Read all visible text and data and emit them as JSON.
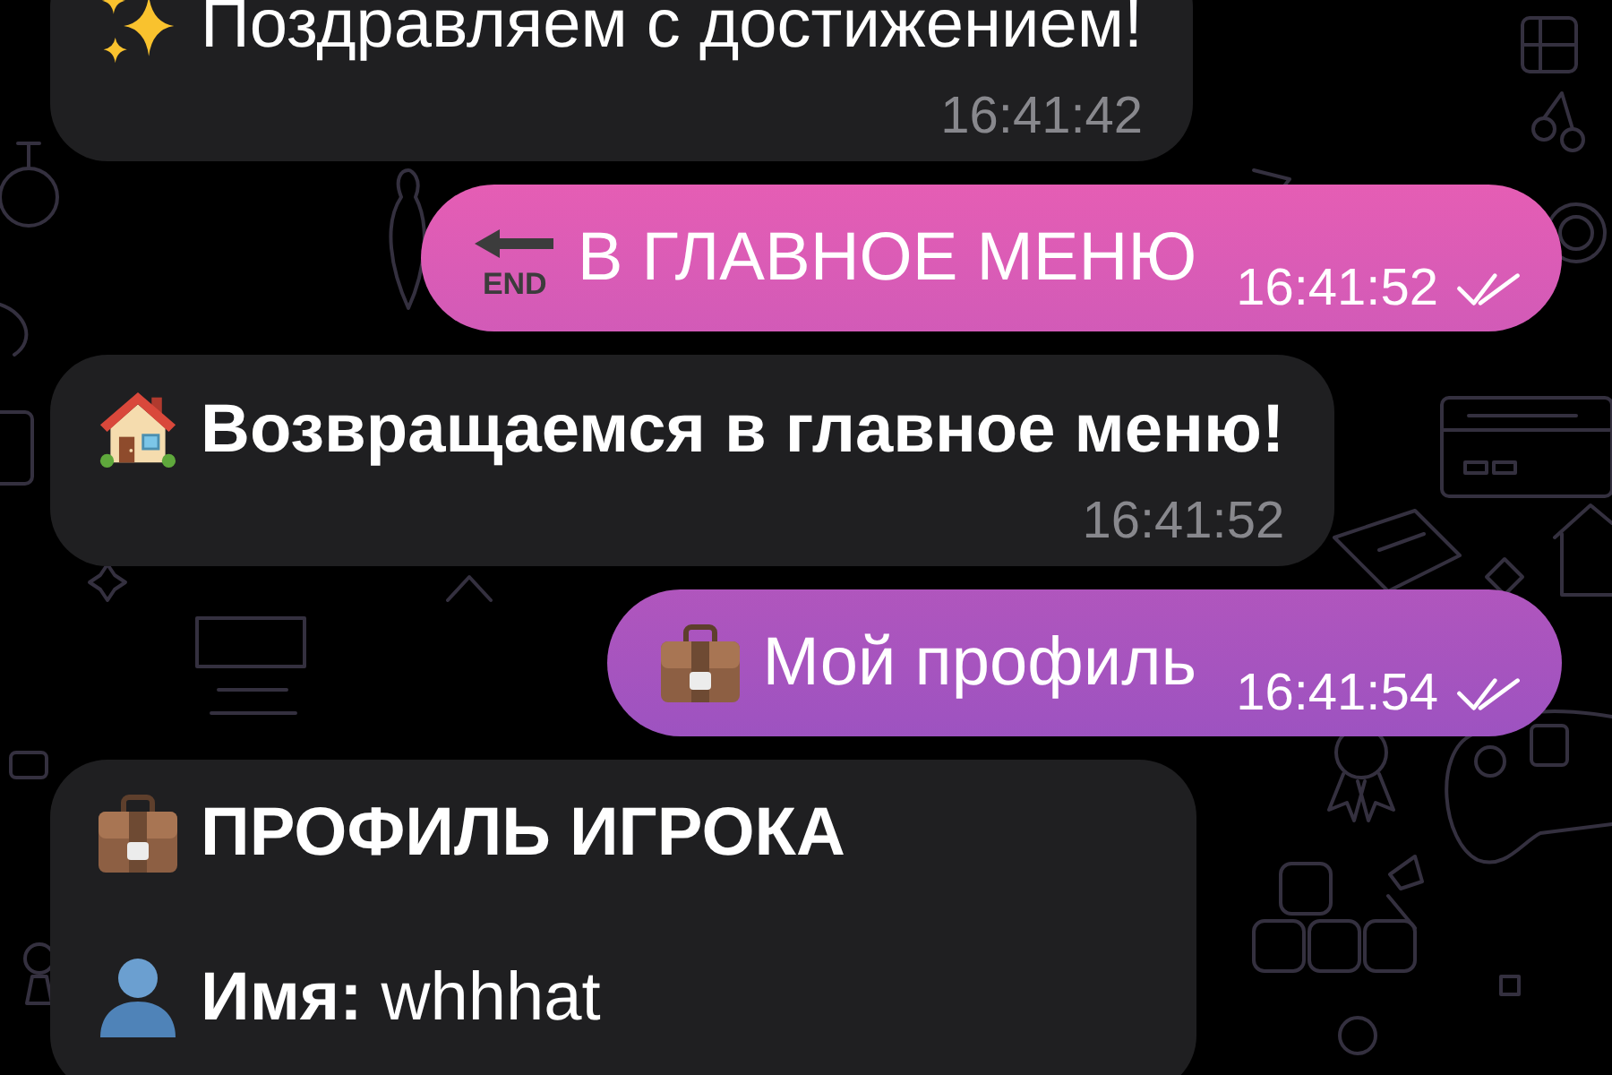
{
  "chat": {
    "messages": [
      {
        "kind": "text",
        "outgoing": false,
        "text": "Поздравляем с достижением!",
        "time": "16:41:42"
      },
      {
        "kind": "text",
        "outgoing": true,
        "icon_text": "END",
        "text": "В ГЛАВНОЕ МЕНЮ",
        "time": "16:41:52",
        "read": true
      },
      {
        "kind": "text",
        "outgoing": false,
        "text": "Возвращаемся в главное меню!",
        "time": "16:41:52"
      },
      {
        "kind": "text",
        "outgoing": true,
        "text": "Мой профиль",
        "time": "16:41:54",
        "read": true
      },
      {
        "kind": "profile_card",
        "outgoing": false,
        "title": "ПРОФИЛЬ ИГРОКА",
        "lines": [
          "**Имя:** whhhat"
        ]
      }
    ]
  }
}
